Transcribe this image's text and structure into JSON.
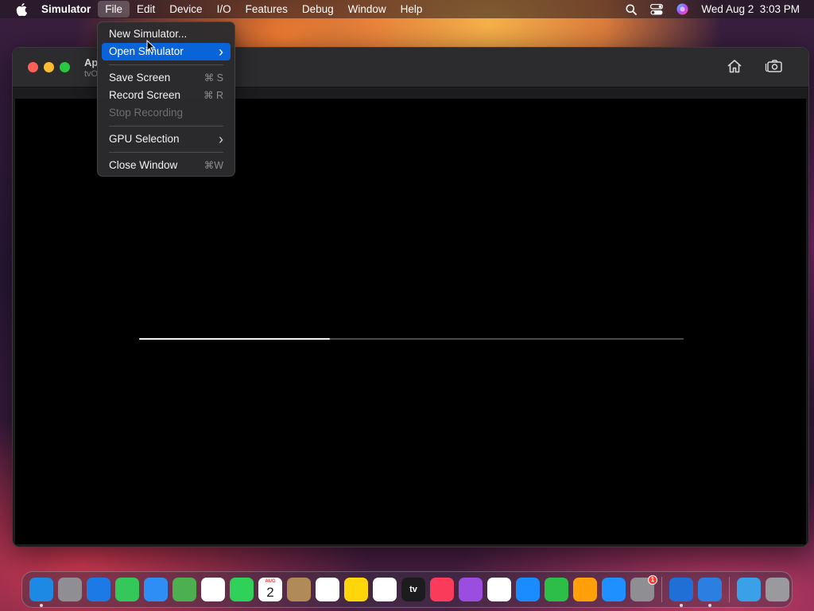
{
  "menubar": {
    "app_name": "Simulator",
    "menus": [
      "File",
      "Edit",
      "Device",
      "I/O",
      "Features",
      "Debug",
      "Window",
      "Help"
    ],
    "active_menu": "File",
    "clock": "Wed Aug 2  3:03 PM",
    "status_icons": [
      "search-icon",
      "control-center-icon",
      "siri-icon"
    ]
  },
  "file_menu": {
    "items": [
      {
        "label": "New Simulator...",
        "shortcut": "",
        "submenu": false,
        "enabled": true,
        "highlighted": false
      },
      {
        "label": "Open Simulator",
        "shortcut": "",
        "submenu": true,
        "enabled": true,
        "highlighted": true
      },
      {
        "separator": true
      },
      {
        "label": "Save Screen",
        "shortcut": "⌘ S",
        "submenu": false,
        "enabled": true,
        "highlighted": false
      },
      {
        "label": "Record Screen",
        "shortcut": "⌘ R",
        "submenu": false,
        "enabled": true,
        "highlighted": false
      },
      {
        "label": "Stop Recording",
        "shortcut": "",
        "submenu": false,
        "enabled": false,
        "highlighted": false
      },
      {
        "separator": true
      },
      {
        "label": "GPU Selection",
        "shortcut": "",
        "submenu": true,
        "enabled": true,
        "highlighted": false
      },
      {
        "separator": true
      },
      {
        "label": "Close Window",
        "shortcut": "⌘W",
        "submenu": false,
        "enabled": true,
        "highlighted": false
      }
    ]
  },
  "window": {
    "title": "Ap",
    "subtitle": "tvO",
    "toolbar_icons": [
      "home-icon",
      "screenshot-icon"
    ],
    "boot_progress": 0.35
  },
  "dock": {
    "apps": [
      {
        "name": "finder-icon",
        "color": "#1e88e5",
        "running": true
      },
      {
        "name": "launchpad-icon",
        "color": "#8e8e93",
        "running": false
      },
      {
        "name": "safari-icon",
        "color": "#1c7ae6",
        "running": false
      },
      {
        "name": "messages-icon",
        "color": "#34c759",
        "running": false
      },
      {
        "name": "mail-icon",
        "color": "#2f8ef5",
        "running": false
      },
      {
        "name": "maps-icon",
        "color": "#4caf50",
        "running": false
      },
      {
        "name": "photos-icon",
        "color": "#ffffff",
        "running": false
      },
      {
        "name": "facetime-icon",
        "color": "#30d158",
        "running": false
      },
      {
        "name": "calendar-icon",
        "color": "#ffffff",
        "running": false,
        "month": "AUG",
        "day": "2"
      },
      {
        "name": "contacts-icon",
        "color": "#b08a57",
        "running": false
      },
      {
        "name": "reminders-icon",
        "color": "#ffffff",
        "running": false
      },
      {
        "name": "notes-icon",
        "color": "#ffd60a",
        "running": false
      },
      {
        "name": "freeform-icon",
        "color": "#ffffff",
        "running": false
      },
      {
        "name": "apple-tv-icon",
        "color": "#1c1c1e",
        "running": false,
        "label": "tv"
      },
      {
        "name": "music-icon",
        "color": "#fa3c5a",
        "running": false
      },
      {
        "name": "podcasts-icon",
        "color": "#9b4de0",
        "running": false
      },
      {
        "name": "news-icon",
        "color": "#ffffff",
        "running": false
      },
      {
        "name": "keynote-icon",
        "color": "#1a8cff",
        "running": false
      },
      {
        "name": "numbers-icon",
        "color": "#2dbe4a",
        "running": false
      },
      {
        "name": "pages-icon",
        "color": "#ff9f0a",
        "running": false
      },
      {
        "name": "app-store-icon",
        "color": "#1e90ff",
        "running": false
      },
      {
        "name": "system-settings-icon",
        "color": "#8e8e93",
        "running": false,
        "badge": "1"
      }
    ],
    "recent": [
      {
        "name": "xcode-icon",
        "color": "#1f6fd6",
        "running": true
      },
      {
        "name": "simulator-icon",
        "color": "#2a7fe0",
        "running": true
      }
    ],
    "extras": [
      {
        "name": "downloads-folder-icon",
        "color": "#3aa0e8"
      },
      {
        "name": "trash-icon",
        "color": "#9a9a9e"
      }
    ]
  }
}
